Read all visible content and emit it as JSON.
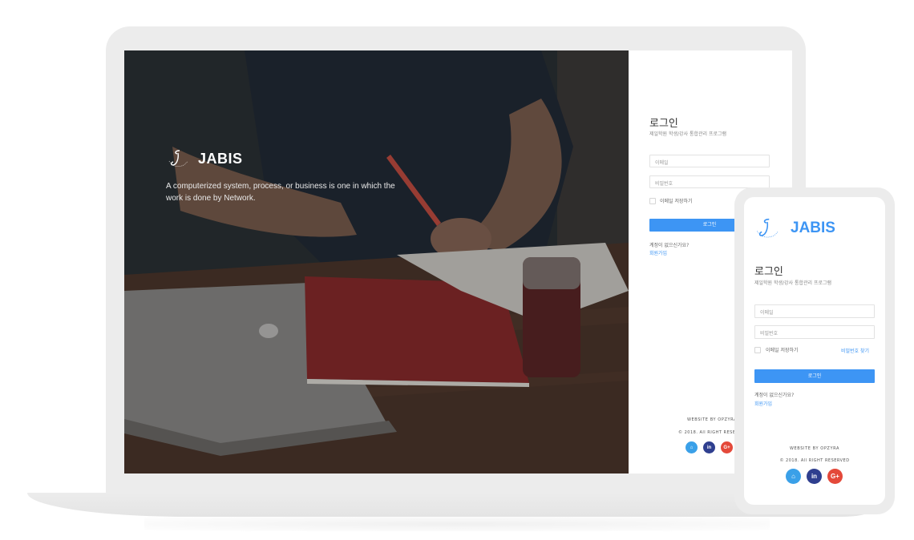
{
  "brand": {
    "name": "JABIS",
    "tagline": "A computerized system, process, or business is one in which the work is done by Network."
  },
  "login": {
    "title": "로그인",
    "subtitle": "제일학원 학생/강사 통합관리 프로그램",
    "email_placeholder": "이메일",
    "password_placeholder": "비밀번호",
    "remember_label": "이메일 저장하기",
    "forgot_label": "비밀번호 찾기",
    "submit_label": "로그인",
    "no_account": "계정이 없으신가요?",
    "signup_label": "회원가입"
  },
  "footer": {
    "credit": "WEBSITE BY OPZYRA",
    "copyright": "© 2018. All RIGHT RESERVED"
  },
  "socials": [
    {
      "name": "github-icon",
      "glyph": "⌂",
      "color": "#3aa0e8"
    },
    {
      "name": "linkedin-icon",
      "glyph": "in",
      "color": "#2f3f8f"
    },
    {
      "name": "google-plus-icon",
      "glyph": "G+",
      "color": "#e4493a"
    }
  ],
  "colors": {
    "accent": "#3d95f4",
    "mockup_frame": "#ececec"
  }
}
